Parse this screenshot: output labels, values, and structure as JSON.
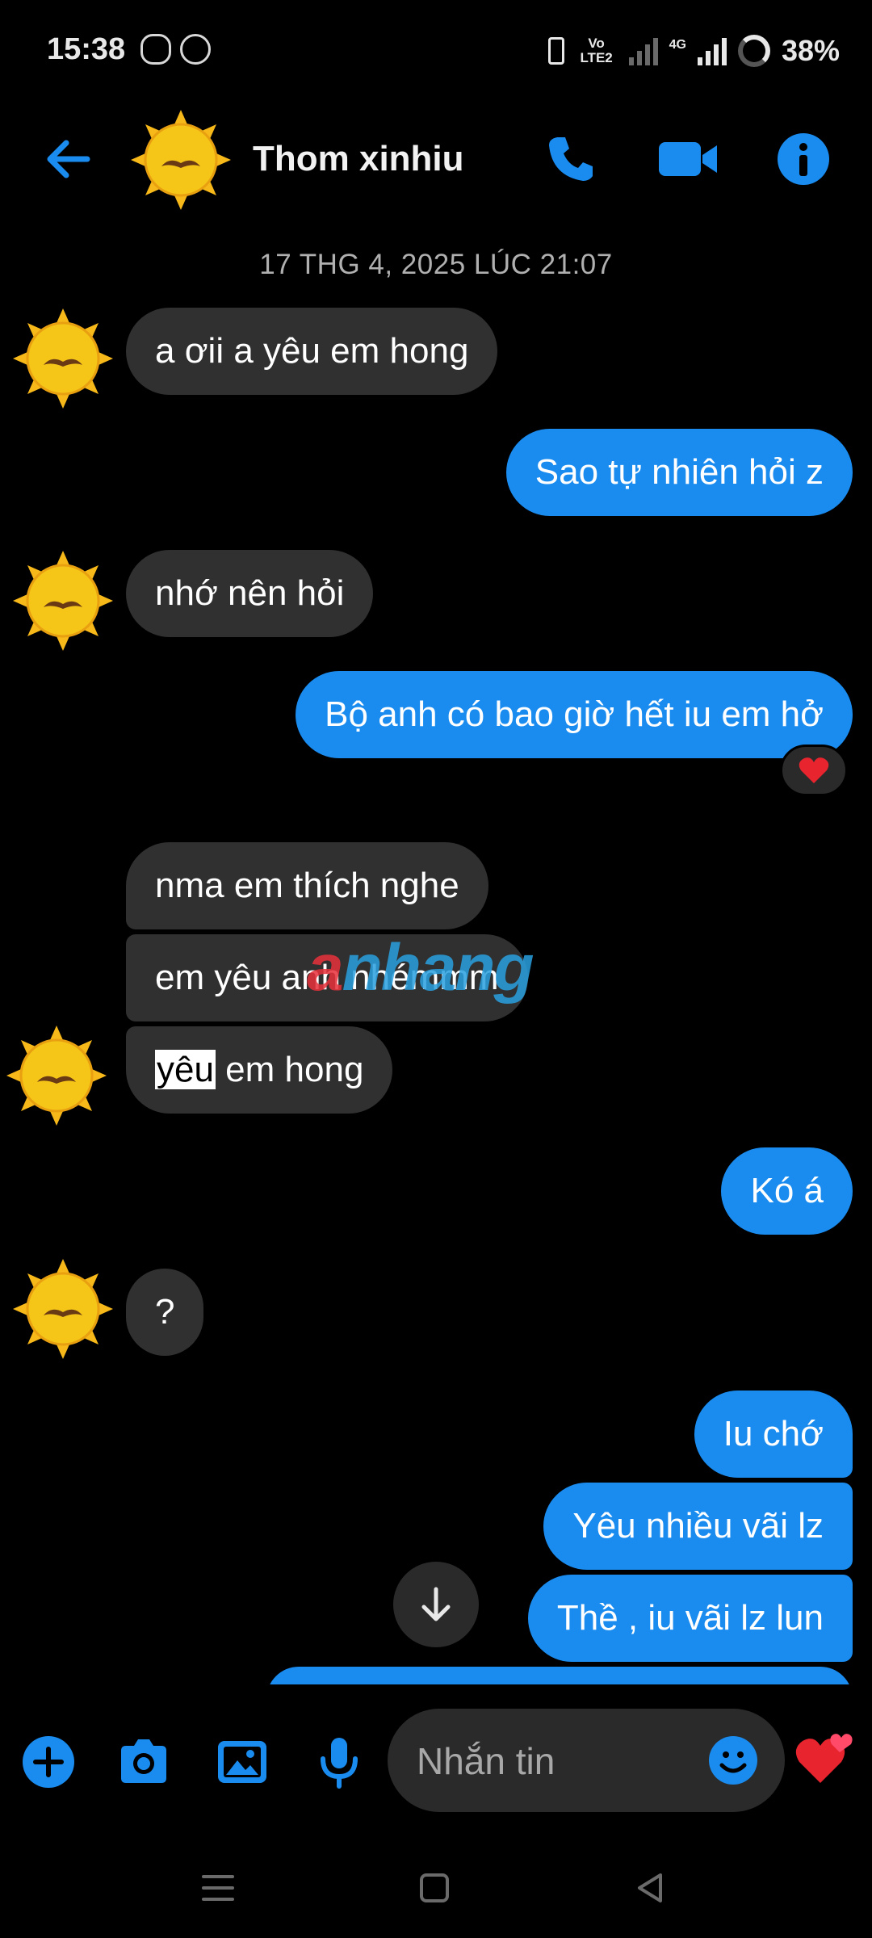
{
  "status": {
    "time": "15:38",
    "volte": "Vo LTE2",
    "network": "4G",
    "battery": "38%"
  },
  "header": {
    "contact_name": "Thom xinhiu"
  },
  "timestamp": "17 THG 4, 2025 LÚC 21:07",
  "messages": [
    {
      "dir": "in",
      "text": "a ơii a yêu em hong"
    },
    {
      "dir": "out",
      "text": "Sao tự nhiên hỏi z"
    },
    {
      "dir": "in",
      "text": "nhớ nên hỏi"
    },
    {
      "dir": "out",
      "text": "Bộ anh có bao giờ hết iu em hở",
      "reaction": "heart"
    },
    {
      "dir": "in",
      "text": "nma em thích nghe"
    },
    {
      "dir": "in",
      "text": "em yêu anh nhémmm"
    },
    {
      "dir": "in",
      "text_highlight": "yêu",
      "text_rest": " em hong"
    },
    {
      "dir": "out",
      "text": "Kó á"
    },
    {
      "dir": "in",
      "text": "?"
    },
    {
      "dir": "out",
      "text": "Iu chớ"
    },
    {
      "dir": "out",
      "text": "Yêu nhiều vãi lz"
    },
    {
      "dir": "out",
      "text": "Thề , iu vãi lz lun"
    }
  ],
  "watermark": {
    "part1": "a",
    "part2": "nhang"
  },
  "composer": {
    "placeholder": "Nhắn tin"
  },
  "colors": {
    "accent": "#1a8cf0",
    "incoming_bubble": "#303030",
    "background": "#000000"
  }
}
